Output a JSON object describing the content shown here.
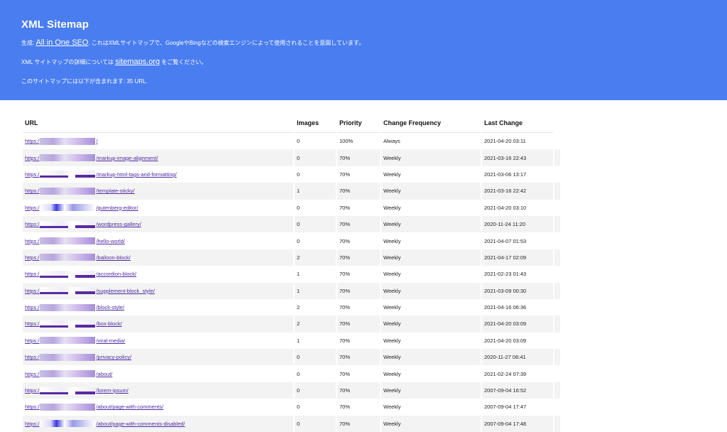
{
  "header": {
    "title": "XML Sitemap",
    "line1_prefix": "生成: ",
    "line1_link": "All in One SEO",
    "line1_suffix": ". これはXMLサイトマップで、GoogleやBingなどの検索エンジンによって使用されることを意図しています。",
    "line2_prefix": "XML サイトマップの詳細については ",
    "line2_link": "sitemaps.org",
    "line2_suffix": " をご覧ください。",
    "line3": "このサイトマップには以下が含まれます: 35 URL."
  },
  "table": {
    "columns": [
      "URL",
      "Images",
      "Priority",
      "Change Frequency",
      "Last Change"
    ],
    "url_prefix": "https:/",
    "rows": [
      {
        "path": "/",
        "images": "0",
        "priority": "100%",
        "freq": "Always",
        "last": "2021-04-20 03:11",
        "mask": "a"
      },
      {
        "path": "/markup-image-alignment/",
        "images": "0",
        "priority": "70%",
        "freq": "Weekly",
        "last": "2021-03-16 22:43",
        "mask": "a"
      },
      {
        "path": "/markup-html-tags-and-formatting/",
        "images": "0",
        "priority": "70%",
        "freq": "Weekly",
        "last": "2021-03-06 13:17",
        "mask": "b"
      },
      {
        "path": "/template-sticky/",
        "images": "1",
        "priority": "70%",
        "freq": "Weekly",
        "last": "2021-03-16 22:42",
        "mask": "a"
      },
      {
        "path": "/gutenberg-editor/",
        "images": "0",
        "priority": "70%",
        "freq": "Weekly",
        "last": "2021-04-20 03:10",
        "mask": "c"
      },
      {
        "path": "/wordpress-gallery/",
        "images": "0",
        "priority": "70%",
        "freq": "Weekly",
        "last": "2020-11-24 11:20",
        "mask": "b"
      },
      {
        "path": "/hello-world/",
        "images": "0",
        "priority": "70%",
        "freq": "Weekly",
        "last": "2021-04-07 01:53",
        "mask": "a"
      },
      {
        "path": "/balloon-block/",
        "images": "2",
        "priority": "70%",
        "freq": "Weekly",
        "last": "2021-04-17 02:09",
        "mask": "a"
      },
      {
        "path": "/accordion-block/",
        "images": "1",
        "priority": "70%",
        "freq": "Weekly",
        "last": "2021-02-23 01:43",
        "mask": "b"
      },
      {
        "path": "/supplement-block_style/",
        "images": "1",
        "priority": "70%",
        "freq": "Weekly",
        "last": "2021-03-09 00:30",
        "mask": "b"
      },
      {
        "path": "/block-style/",
        "images": "2",
        "priority": "70%",
        "freq": "Weekly",
        "last": "2021-04-16 06:36",
        "mask": "a"
      },
      {
        "path": "/box-block/",
        "images": "2",
        "priority": "70%",
        "freq": "Weekly",
        "last": "2021-04-20 03:09",
        "mask": "b"
      },
      {
        "path": "/viral-media/",
        "images": "1",
        "priority": "70%",
        "freq": "Weekly",
        "last": "2021-04-20 03:09",
        "mask": "a"
      },
      {
        "path": "/privacy-policy/",
        "images": "0",
        "priority": "70%",
        "freq": "Weekly",
        "last": "2020-11-27 06:41",
        "mask": "a"
      },
      {
        "path": "/about/",
        "images": "0",
        "priority": "70%",
        "freq": "Weekly",
        "last": "2021-02-24 07:39",
        "mask": "a"
      },
      {
        "path": "/lorem-ipsum/",
        "images": "0",
        "priority": "70%",
        "freq": "Weekly",
        "last": "2007-09-04 16:52",
        "mask": "b"
      },
      {
        "path": "/about/page-with-comments/",
        "images": "0",
        "priority": "70%",
        "freq": "Weekly",
        "last": "2007-09-04 17:47",
        "mask": "a"
      },
      {
        "path": "/about/page-with-comments-disabled/",
        "images": "0",
        "priority": "70%",
        "freq": "Weekly",
        "last": "2007-09-04 17:48",
        "mask": "c"
      }
    ]
  }
}
